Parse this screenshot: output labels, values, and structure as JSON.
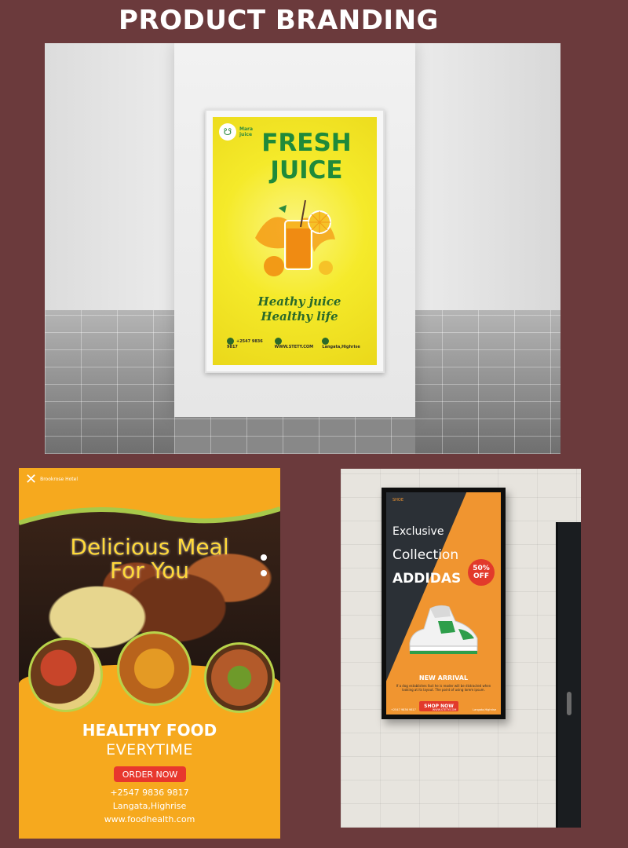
{
  "page": {
    "title": "PRODUCT BRANDING"
  },
  "juice_poster": {
    "logo_text": "Mara juice",
    "title": "FRESH JUICE",
    "tagline_1": "Heathy juice",
    "tagline_2": "Healthy life",
    "phone": "+2547 9836 9817",
    "website": "WWW.STETY.COM",
    "location": "Langata,Highrise",
    "colors": {
      "background": "#f5ea2a",
      "title": "#1f8a3a"
    }
  },
  "food_poster": {
    "logo_text": "Brookrose Hotel",
    "headline_1": "Delicious Meal",
    "headline_2": "For You",
    "heading": "HEALTHY FOOD",
    "subheading": "EVERYTIME",
    "button_label": "ORDER NOW",
    "phone": "+2547 9836 9817",
    "location": "Langata,Highrise",
    "website": "www.foodhealth.com",
    "colors": {
      "background": "#f6a91e",
      "button": "#e8372d",
      "headline": "#ffd93a"
    }
  },
  "shoe_poster": {
    "brand": "SHOE",
    "line_1": "Exclusive",
    "line_2": "Collection",
    "line_3": "ADDIDAS",
    "badge_top": "50%",
    "badge_bottom": "OFF",
    "arrival": "NEW ARRIVAL",
    "description": "If a dog establishes fact he is reader will be distracted when looking at its layout. The point of using lorem ipsum.",
    "button_label": "SHOP NOW",
    "phone": "+2547 9836 9817",
    "website": "WWW.STETY.COM",
    "location": "Langata,Highrise",
    "colors": {
      "accent": "#f09530",
      "dark": "#2b3036",
      "badge": "#e23a2b"
    }
  }
}
